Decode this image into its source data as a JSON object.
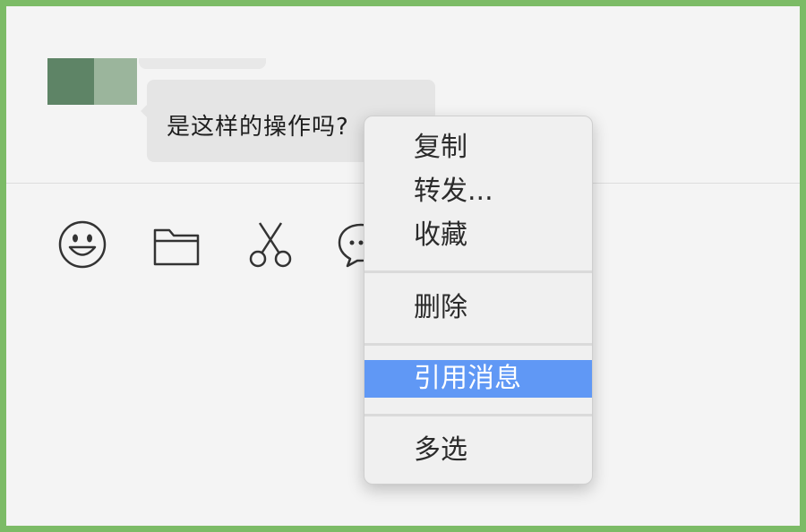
{
  "message": {
    "text": "是这样的操作吗?"
  },
  "toolbar": {
    "icons": [
      "emoji-icon",
      "folder-icon",
      "scissors-icon",
      "chat-bubble-icon"
    ]
  },
  "context_menu": {
    "items": [
      {
        "label": "复制"
      },
      {
        "label": "转发..."
      },
      {
        "label": "收藏"
      },
      {
        "label": "删除"
      },
      {
        "label": "引用消息"
      },
      {
        "label": "多选"
      }
    ],
    "highlight_color": "#6098f5"
  },
  "colors": {
    "frame": "#7cbb66",
    "avatar_dark": "#5e8466",
    "avatar_light": "#9bb59c"
  }
}
